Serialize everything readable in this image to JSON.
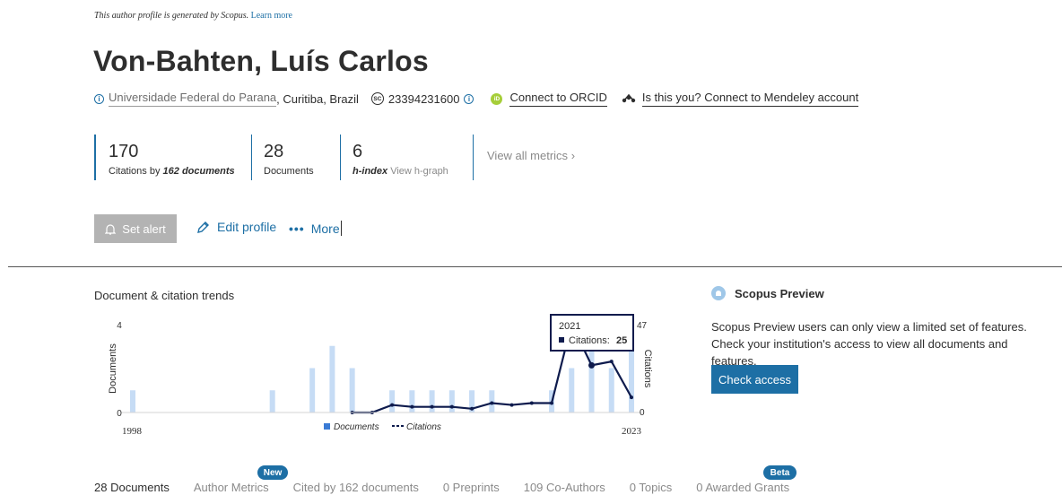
{
  "notice": {
    "text": "This author profile is generated by Scopus.",
    "link": "Learn more"
  },
  "author": {
    "name": "Von-Bahten, Luís Carlos",
    "affiliation": "Universidade Federal do Parana",
    "location": ", Curitiba, Brazil",
    "author_id": "23394231600",
    "orcid_label": "Connect to ORCID",
    "mendeley_label": "Is this you? Connect to Mendeley account"
  },
  "metrics": {
    "citations": {
      "value": "170",
      "label_prefix": "Citations by ",
      "label_bold": "162 documents"
    },
    "documents": {
      "value": "28",
      "label": "Documents"
    },
    "hindex": {
      "value": "6",
      "label_bold": "h-index",
      "label_link": "View h-graph"
    },
    "view_all": "View all metrics"
  },
  "actions": {
    "set_alert": "Set alert",
    "edit_profile": "Edit profile",
    "more": "More"
  },
  "trends": {
    "title": "Document & citation trends",
    "tooltip": {
      "year": "2021",
      "label": "Citations:",
      "value": "25"
    },
    "legend": {
      "documents": "Documents",
      "citations": "Citations"
    }
  },
  "chart_data": {
    "type": "bar+line",
    "x_range": [
      "1998",
      "2023"
    ],
    "categories": [
      1998,
      1999,
      2000,
      2001,
      2002,
      2003,
      2004,
      2005,
      2006,
      2007,
      2008,
      2009,
      2010,
      2011,
      2012,
      2013,
      2014,
      2015,
      2016,
      2017,
      2018,
      2019,
      2020,
      2021,
      2022,
      2023
    ],
    "series": [
      {
        "name": "Documents",
        "axis": "left",
        "type": "bar",
        "values": [
          1,
          0,
          0,
          0,
          0,
          0,
          0,
          1,
          0,
          2,
          3,
          2,
          0,
          1,
          1,
          1,
          1,
          1,
          1,
          0,
          0,
          1,
          2,
          4,
          2,
          3
        ]
      },
      {
        "name": "Citations",
        "axis": "right",
        "type": "line",
        "values": [
          null,
          null,
          null,
          null,
          null,
          null,
          null,
          null,
          null,
          null,
          null,
          0,
          0,
          4,
          3,
          3,
          3,
          2,
          5,
          4,
          5,
          5,
          47,
          25,
          27,
          8
        ]
      }
    ],
    "ylabel_left": "Documents",
    "ylim_left": [
      0,
      4
    ],
    "ylabel_right": "Citations",
    "ylim_right": [
      0,
      47
    ],
    "colors": {
      "bars": "#c6dcf5",
      "line": "#0e1b4d"
    }
  },
  "preview": {
    "title": "Scopus Preview",
    "text": "Scopus Preview users can only view a limited set of features. Check your institution's access to view all documents and features.",
    "button": "Check access"
  },
  "tabs": [
    {
      "label": "28 Documents"
    },
    {
      "label": "Author Metrics"
    },
    {
      "label": "Cited by 162 documents"
    },
    {
      "label": "0 Preprints"
    },
    {
      "label": "109 Co-Authors"
    },
    {
      "label": "0 Topics"
    },
    {
      "label": "0 Awarded Grants"
    }
  ],
  "badges": {
    "new": "New",
    "beta": "Beta"
  }
}
